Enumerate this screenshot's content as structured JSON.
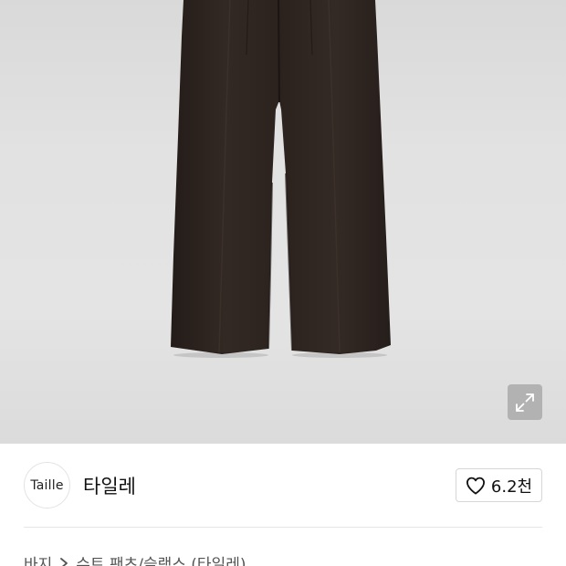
{
  "product_image": {
    "alt": "brown wide pleated slacks",
    "pants_color": "#2e2521",
    "expand_icon": "expand-arrows-icon"
  },
  "shop": {
    "logo_text": "Taille",
    "name": "타일레"
  },
  "like": {
    "icon": "heart-outline-icon",
    "count": "6.2천"
  },
  "breadcrumb": {
    "category": "바지",
    "separator_icon": "chevron-right-icon",
    "subcategory": "슈트 팬츠/슬랙스 (타일레)"
  }
}
